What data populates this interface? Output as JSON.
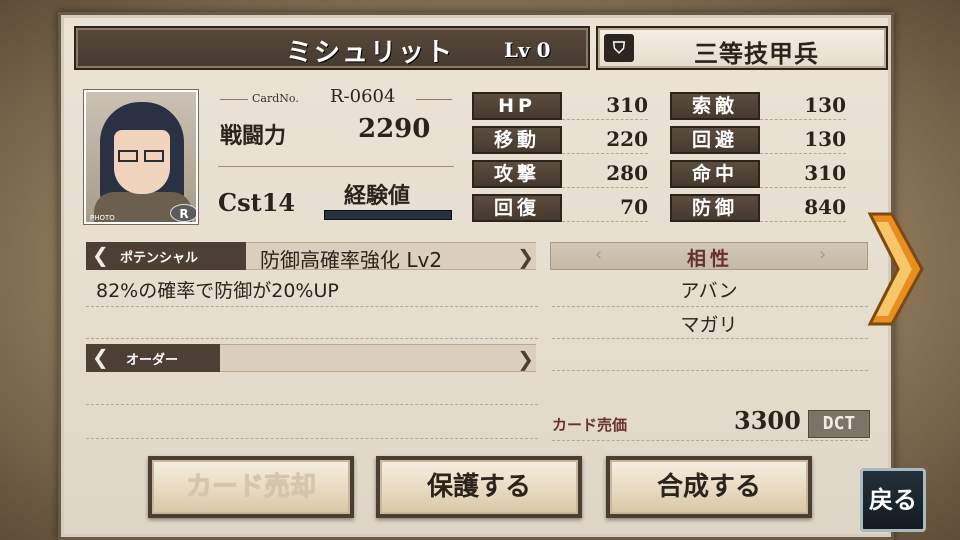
{
  "header": {
    "name": "ミシュリット",
    "level": "Lv 0",
    "rank_icon": "shield-icon",
    "rank": "三等技甲兵"
  },
  "card": {
    "card_no_label": "CardNo.",
    "card_no": "R-0604",
    "power_label": "戦闘力",
    "power": "2290",
    "cost": "Cst14",
    "exp_label": "経験値",
    "exp_progress": 0.0,
    "portrait_caption": "PHOTO",
    "rarity": "R"
  },
  "stats": [
    {
      "label": "HP",
      "value": "310"
    },
    {
      "label": "移動",
      "value": "220"
    },
    {
      "label": "攻撃",
      "value": "280"
    },
    {
      "label": "回復",
      "value": "70"
    },
    {
      "label": "索敵",
      "value": "130"
    },
    {
      "label": "回避",
      "value": "130"
    },
    {
      "label": "命中",
      "value": "310"
    },
    {
      "label": "防御",
      "value": "840"
    }
  ],
  "potential": {
    "tag": "ポテンシャル",
    "name": "防御高確率強化 Lv2",
    "description": "82%の確率で防御が20%UP"
  },
  "order": {
    "tag": "オーダー"
  },
  "affinity": {
    "title": "相性",
    "items": [
      "アバン",
      "マガリ"
    ]
  },
  "sell": {
    "label": "カード売価",
    "value": "3300",
    "unit": "DCT"
  },
  "buttons": {
    "sell": "カード売却",
    "protect": "保護する",
    "combine": "合成する",
    "back": "戻る"
  },
  "colors": {
    "accent_orange": "#f0a23a",
    "dark_label": "#4c4034",
    "affinity_title": "#6a2f2f"
  }
}
